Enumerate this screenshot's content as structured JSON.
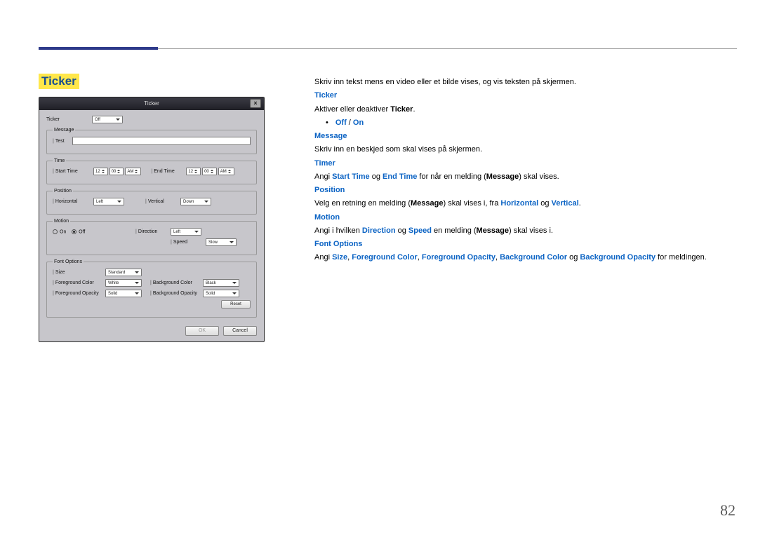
{
  "page_number": "82",
  "section_title": "Ticker",
  "dialog": {
    "title": "Ticker",
    "close_glyph": "×",
    "ticker_label": "Ticker",
    "ticker_value": "Off",
    "message": {
      "legend": "Message",
      "field_label": "Test",
      "value": " "
    },
    "time": {
      "legend": "Time",
      "start_label": "Start Time",
      "end_label": "End Time",
      "start_h": "12",
      "start_m": "00",
      "start_ap": "AM",
      "end_h": "12",
      "end_m": "00",
      "end_ap": "AM"
    },
    "position": {
      "legend": "Position",
      "h_label": "Horizontal",
      "h_value": "Left",
      "v_label": "Vertical",
      "v_value": "Down"
    },
    "motion": {
      "legend": "Motion",
      "on_label": "On",
      "off_label": "Off",
      "dir_label": "Direction",
      "dir_value": "Left",
      "spd_label": "Speed",
      "spd_value": "Slow"
    },
    "font": {
      "legend": "Font Options",
      "size_label": "Size",
      "size_value": "Standard",
      "fgc_label": "Foreground Color",
      "fgc_value": "White",
      "fgo_label": "Foreground Opacity",
      "fgo_value": "Solid",
      "bgc_label": "Background Color",
      "bgc_value": "Black",
      "bgo_label": "Background Opacity",
      "bgo_value": "Solid",
      "reset_label": "Reset"
    },
    "ok_label": "OK",
    "cancel_label": "Cancel"
  },
  "desc": {
    "intro": "Skriv inn tekst mens en video eller et bilde vises, og vis teksten på skjermen.",
    "ticker_h": "Ticker",
    "ticker_t1": "Aktiver eller deaktiver ",
    "ticker_bold": "Ticker",
    "ticker_t2": ".",
    "offon_a": "Off",
    "offon_sep": " / ",
    "offon_b": "On",
    "message_h": "Message",
    "message_t": "Skriv inn en beskjed som skal vises på skjermen.",
    "timer_h": "Timer",
    "timer_t1": "Angi ",
    "timer_b1": "Start Time",
    "timer_t2": " og ",
    "timer_b2": "End Time",
    "timer_t3": " for når en melding (",
    "timer_b3": "Message",
    "timer_t4": ") skal vises.",
    "position_h": "Position",
    "pos_t1": "Velg en retning en melding (",
    "pos_b1": "Message",
    "pos_t2": ") skal vises i, fra ",
    "pos_b2": "Horizontal",
    "pos_t3": " og ",
    "pos_b3": "Vertical",
    "pos_t4": ".",
    "motion_h": "Motion",
    "mot_t1": "Angi i hvilken ",
    "mot_b1": "Direction",
    "mot_t2": " og ",
    "mot_b2": "Speed",
    "mot_t3": " en melding (",
    "mot_b3": "Message",
    "mot_t4": ") skal vises i.",
    "font_h": "Font Options",
    "font_t1": "Angi ",
    "font_b1": "Size",
    "font_t2": ", ",
    "font_b2": "Foreground Color",
    "font_t3": ", ",
    "font_b3": "Foreground Opacity",
    "font_t4": ", ",
    "font_b4": "Background Color",
    "font_t5": " og ",
    "font_b5": "Background Opacity",
    "font_t6": " for meldingen."
  }
}
